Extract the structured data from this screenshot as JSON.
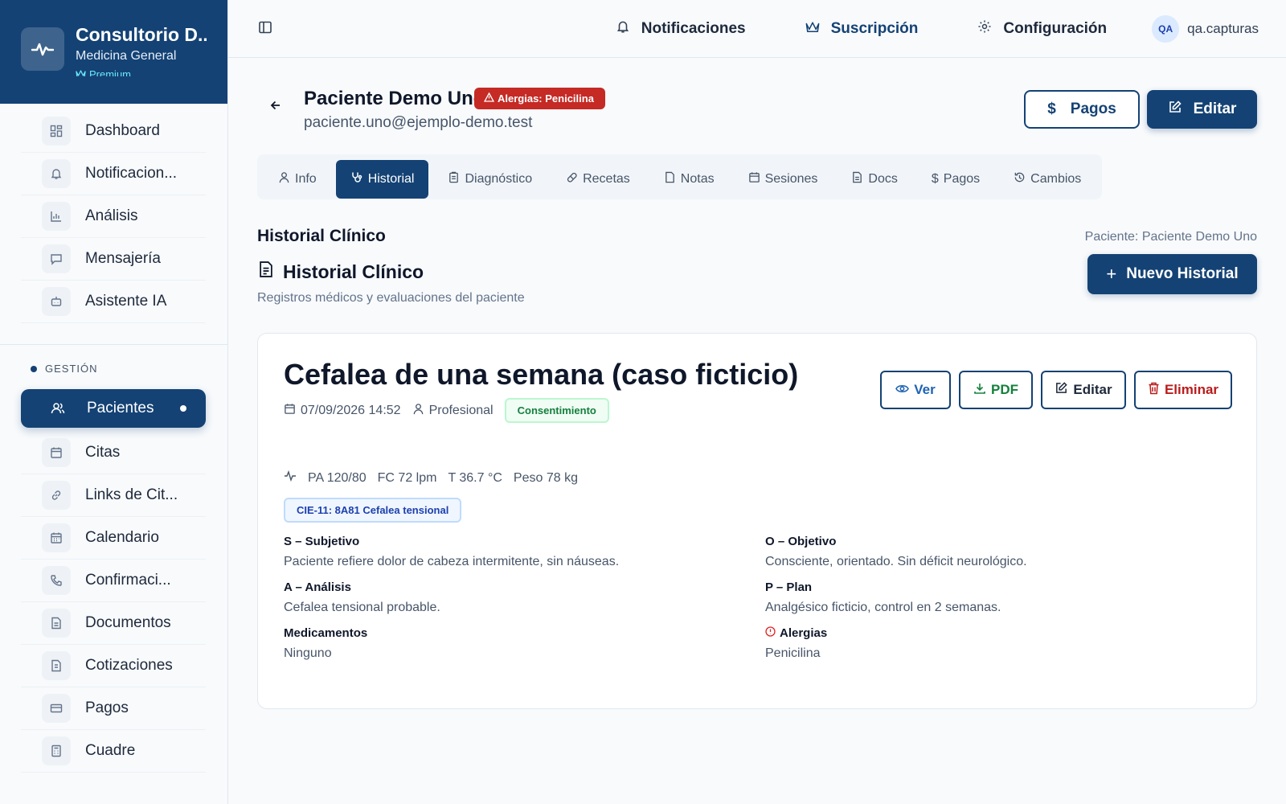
{
  "brand": {
    "title": "Consultorio D...",
    "subtitle": "Medicina General",
    "plan": "Premium"
  },
  "sidebar": {
    "items": [
      {
        "label": "Dashboard",
        "icon": "grid-icon"
      },
      {
        "label": "Notificacion...",
        "icon": "bell-icon"
      },
      {
        "label": "Análisis",
        "icon": "bar-chart-icon"
      },
      {
        "label": "Mensajería",
        "icon": "message-icon"
      },
      {
        "label": "Asistente IA",
        "icon": "bot-icon"
      }
    ],
    "section_label": "GESTIÓN",
    "gestion": [
      {
        "label": "Pacientes",
        "icon": "users-icon"
      },
      {
        "label": "Citas",
        "icon": "calendar-icon"
      },
      {
        "label": "Links de Cit...",
        "icon": "link-icon"
      },
      {
        "label": "Calendario",
        "icon": "calendar-grid-icon"
      },
      {
        "label": "Confirmaci...",
        "icon": "phone-icon"
      },
      {
        "label": "Documentos",
        "icon": "document-icon"
      },
      {
        "label": "Cotizaciones",
        "icon": "quote-icon"
      },
      {
        "label": "Pagos",
        "icon": "credit-card-icon"
      },
      {
        "label": "Cuadre",
        "icon": "calculator-icon"
      }
    ]
  },
  "topbar": {
    "notifications": "Notificaciones",
    "subscription": "Suscripción",
    "settings": "Configuración",
    "avatar_initials": "QA",
    "username": "qa.capturas"
  },
  "patient": {
    "name": "Paciente Demo Uno",
    "allergy_badge": "Alergias: Penicilina",
    "email": "paciente.uno@ejemplo-demo.test",
    "payments_button": "Pagos",
    "edit_button": "Editar"
  },
  "tabs": [
    "Info",
    "Historial",
    "Diagnóstico",
    "Recetas",
    "Notas",
    "Sesiones",
    "Docs",
    "Pagos",
    "Cambios"
  ],
  "section": {
    "title": "Historial Clínico",
    "patient_label": "Paciente: Paciente Demo Uno",
    "history_title": "Historial Clínico",
    "history_subtitle": "Registros médicos y evaluaciones del paciente",
    "new_button": "Nuevo Historial"
  },
  "record": {
    "title": "Cefalea de una semana (caso ficticio)",
    "datetime": "07/09/2026 14:52",
    "professional": "Profesional",
    "consent": "Consentimiento",
    "actions": {
      "view": "Ver",
      "pdf": "PDF",
      "edit": "Editar",
      "delete": "Eliminar"
    },
    "vitals": {
      "pa": "PA 120/80",
      "fc": "FC 72 lpm",
      "t": "T 36.7 °C",
      "peso": "Peso 78 kg"
    },
    "cie": "CIE-11: 8A81 Cefalea tensional",
    "soap": {
      "s_label": "S – Subjetivo",
      "s_value": "Paciente refiere dolor de cabeza intermitente, sin náuseas.",
      "o_label": "O – Objetivo",
      "o_value": "Consciente, orientado. Sin déficit neurológico.",
      "a_label": "A – Análisis",
      "a_value": "Cefalea tensional probable.",
      "p_label": "P – Plan",
      "p_value": "Analgésico ficticio, control en 2 semanas.",
      "med_label": "Medicamentos",
      "med_value": "Ninguno",
      "alg_label": "Alergias",
      "alg_value": "Penicilina"
    }
  },
  "colors": {
    "primary": "#144274",
    "danger": "#c52a25",
    "success": "#15803d",
    "accent": "#67e8f9"
  }
}
